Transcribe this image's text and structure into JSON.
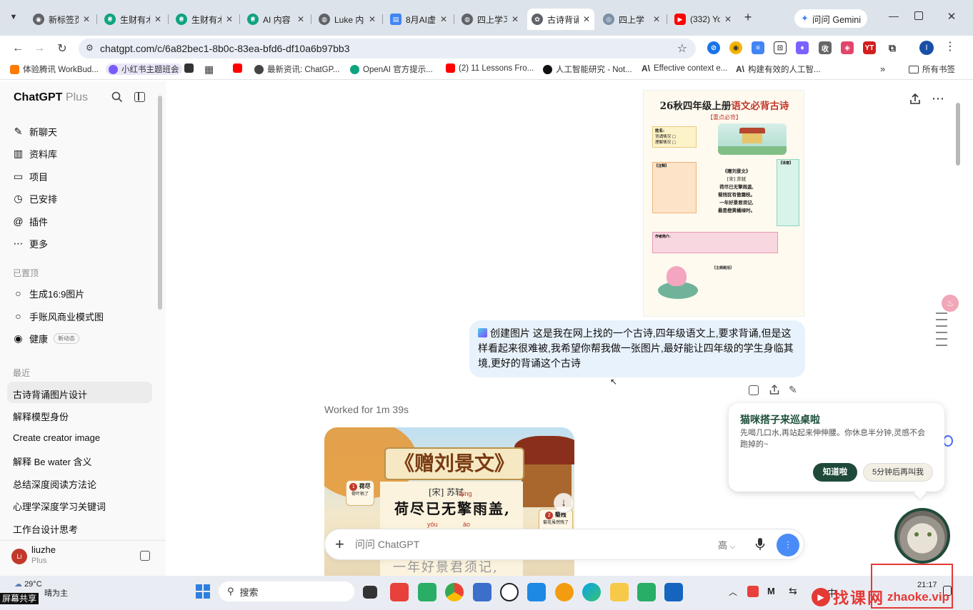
{
  "browser": {
    "tabs": [
      {
        "label": "新标签页",
        "color": "#5f6368"
      },
      {
        "label": "生财有术",
        "color": "#10a37f"
      },
      {
        "label": "生财有术",
        "color": "#10a37f"
      },
      {
        "label": "AI 内容",
        "color": "#10a37f"
      },
      {
        "label": "Luke 内",
        "color": "#5f6368"
      },
      {
        "label": "8月AI虚",
        "color": "#4285f4"
      },
      {
        "label": "四上学习",
        "color": "#5f6368"
      },
      {
        "label": "古诗背诵",
        "color": "#5f6368"
      },
      {
        "label": "四上学",
        "color": "#5f6368"
      },
      {
        "label": "(332) Yo",
        "color": "#ff0000"
      }
    ],
    "gemini_label": "问问 Gemini",
    "url": "chatgpt.com/c/6a82bec1-8b0c-83ea-bfd6-df10a6b97bb3",
    "bookmarks": [
      "体验腾讯 WorkBud...",
      "小红书主题班会",
      "最新资讯: ChatGP...",
      "OpenAI 官方提示...",
      "(2) 11 Lessons Fro...",
      "人工智能研究 - Not...",
      "Effective context e...",
      "构建有效的人工智..."
    ],
    "all_bookmarks": "所有书签"
  },
  "sidebar": {
    "brand": "ChatGPT",
    "plan": "Plus",
    "nav": [
      "新聊天",
      "资料库",
      "项目",
      "已安排",
      "插件",
      "更多"
    ],
    "pinned_title": "已置顶",
    "pinned": [
      "生成16:9图片",
      "手账风商业模式图",
      "健康"
    ],
    "health_badge": "新动态",
    "recent_title": "最近",
    "recent": [
      "古诗背诵图片设计",
      "解释模型身份",
      "Create creator image",
      "解释 Be water 含义",
      "总结深度阅读方法论",
      "心理学深度学习关键词",
      "工作台设计思考"
    ],
    "user_name": "liuzhe",
    "user_plan": "Plus",
    "user_initial": "Li"
  },
  "chat": {
    "poster": {
      "title_prefix": "26秋四年级上册",
      "title_highlight": "语文必背古诗",
      "subtitle": "【重点必背】",
      "checklist": [
        "背诵情况",
        "理解情况"
      ],
      "name_label": "姓名:",
      "poem_title": "《赠刘景文》",
      "poem_author": "[宋] 苏轼",
      "poem_lines": [
        "荷尽已无擎雨盖,",
        "菊残犹有傲霜枝。",
        "一年好景君须记,",
        "最是橙黄橘绿时。"
      ],
      "notes_label": "【注释】",
      "translation_label": "【译意】",
      "author_label": "作者简介:",
      "theme_label": "【主题概括】"
    },
    "user_message": "创建图片 这是我在网上找的一个古诗,四年级语文上,要求背诵,但是这样看起来很难被,我希望你帮我做一张图片,最好能让四年级的学生身临其境,更好的背诵这个古诗",
    "worked_for": "Worked for 1m 39s",
    "generated": {
      "title": "《赠刘景文》",
      "author": "[宋] 苏轼",
      "line1": "荷尽已无擎雨盖,",
      "pinyin_qing": "qíng",
      "pinyin_you": "yóu",
      "pinyin_ao": "ào",
      "line3_partial": "一年好景君须记,",
      "label1_num": "1",
      "label1_title": "荷尽",
      "label1_sub": "荷叶枯了",
      "label2_num": "2",
      "label2_title": "菊残",
      "label2_sub": "菊花虽然残了"
    },
    "composer_placeholder": "问问 ChatGPT",
    "model_label": "高"
  },
  "popup": {
    "title": "猫咪搭子来巡桌啦",
    "body": "先喝几口水,再站起来伸伸腰。你休息半分钟,灵感不会跑掉的~",
    "primary": "知道啦",
    "secondary": "5分钟后再叫我"
  },
  "taskbar": {
    "weather_temp": "29°C",
    "weather_desc": "晴为主",
    "search_label": "搜索",
    "time": "21:17",
    "lang": "中",
    "share_label": "屏幕共享"
  },
  "watermark": {
    "text1": "找课网",
    "text2": "zhaoke.vip"
  }
}
